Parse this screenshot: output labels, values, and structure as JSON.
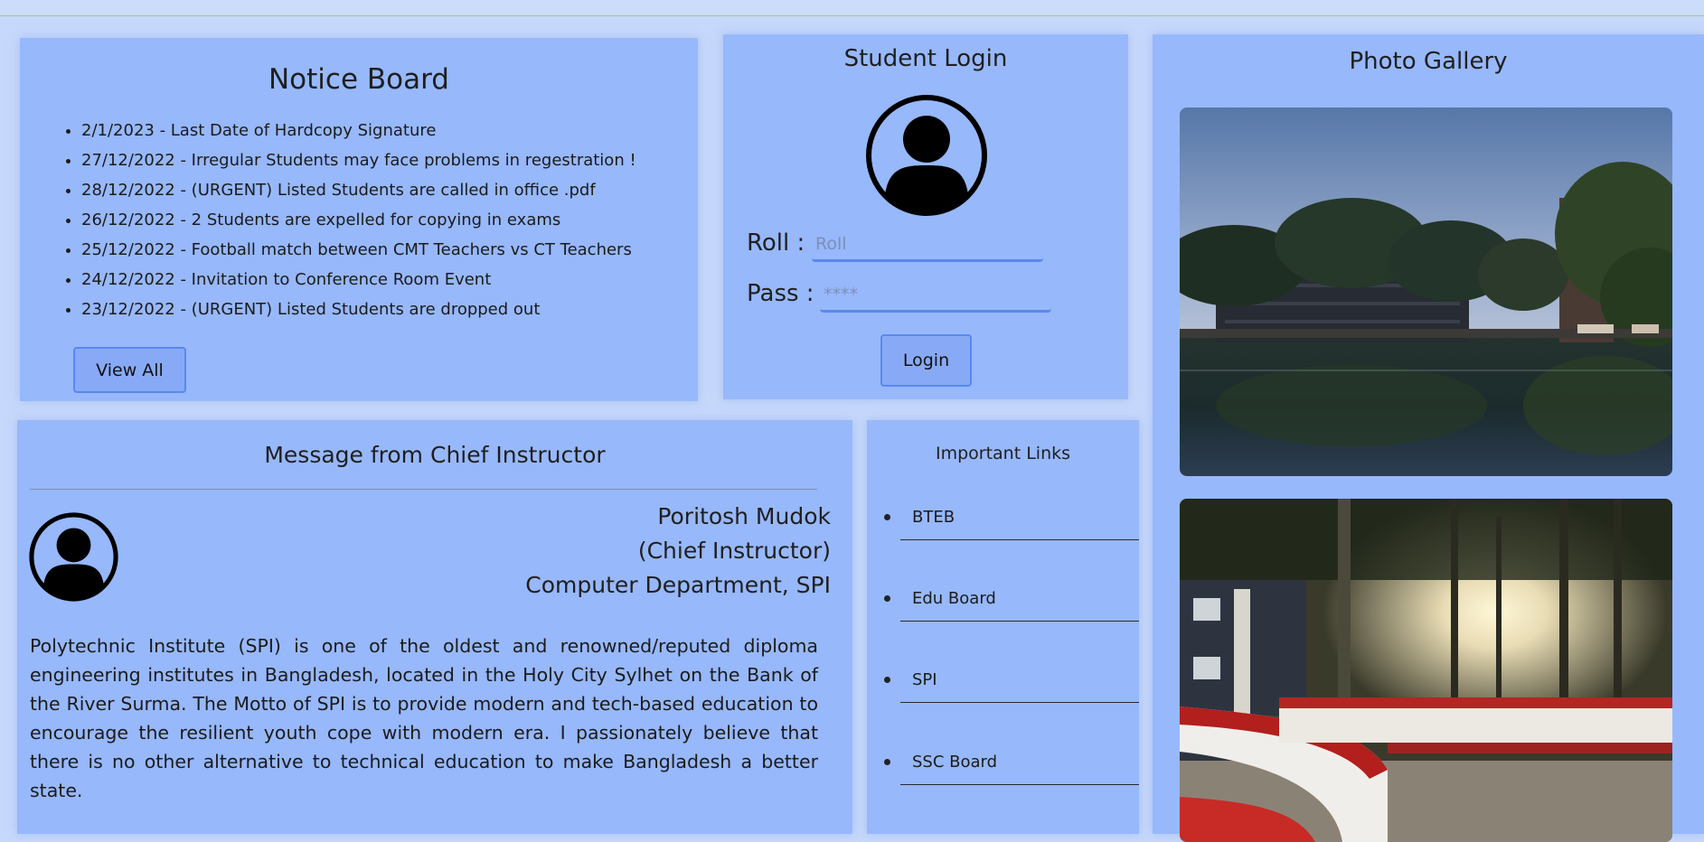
{
  "notice_board": {
    "title": "Notice Board",
    "items": [
      "2/1/2023 - Last Date of Hardcopy Signature",
      "27/12/2022 - Irregular Students may face problems in regestration !",
      "28/12/2022 - (URGENT) Listed Students are called in office .pdf",
      "26/12/2022 - 2 Students are expelled for copying in exams",
      "25/12/2022 - Football match between CMT Teachers vs CT Teachers",
      "24/12/2022 - Invitation to Conference Room Event",
      "23/12/2022 - (URGENT) Listed Students are dropped out"
    ],
    "view_all_label": "View All"
  },
  "student_login": {
    "title": "Student Login",
    "roll_label": "Roll :",
    "roll_placeholder": "Roll",
    "pass_label": "Pass :",
    "pass_placeholder": "****",
    "login_label": "Login",
    "avatar_icon": "user-circle-icon"
  },
  "photo_gallery": {
    "title": "Photo Gallery",
    "photos": [
      "campus-pond-photo",
      "campus-walkway-photo"
    ]
  },
  "message": {
    "title": "Message from Chief Instructor",
    "name": "Poritosh Mudok",
    "role": "(Chief Instructor)",
    "department": "Computer Department, SPI",
    "body": "Polytechnic Institute (SPI) is one of the oldest and renowned/reputed diploma engineering institutes in Bangladesh, located in the Holy City Sylhet on the Bank of the River Surma. The Motto of SPI is to provide modern and tech-based education to encourage the resilient youth cope with modern era. I passionately believe that there is no other alternative to technical education to make Bangladesh a better state.",
    "avatar_icon": "user-circle-icon"
  },
  "important_links": {
    "title": "Important Links",
    "items": [
      "BTEB",
      "Edu Board",
      "SPI",
      "SSC Board"
    ]
  },
  "colors": {
    "page_background": "#c6d8fb",
    "panel_background": "#97b8fb",
    "button_background": "#88aaf6",
    "button_border": "#5a88ee"
  }
}
